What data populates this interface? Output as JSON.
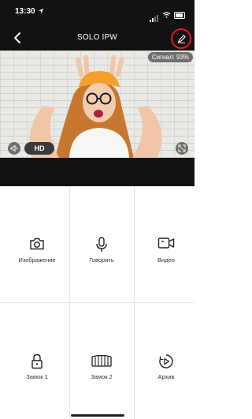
{
  "status_bar": {
    "time": "13:30"
  },
  "nav": {
    "title": "SOLO IPW"
  },
  "video": {
    "signal_label": "Сигнал: 93%",
    "quality": "HD"
  },
  "actions": [
    {
      "label": "Изображение",
      "icon": "camera-icon"
    },
    {
      "label": "Говорить",
      "icon": "microphone-icon"
    },
    {
      "label": "Видео",
      "icon": "video-camera-icon"
    },
    {
      "label": "Замок 1",
      "icon": "lock-icon"
    },
    {
      "label": "Замок 2",
      "icon": "gate-icon"
    },
    {
      "label": "Архив",
      "icon": "play-archive-icon"
    }
  ],
  "colors": {
    "edit_highlight": "#e11c1c",
    "dark_bg": "#121212",
    "accent_orange": "#f2a12e"
  }
}
